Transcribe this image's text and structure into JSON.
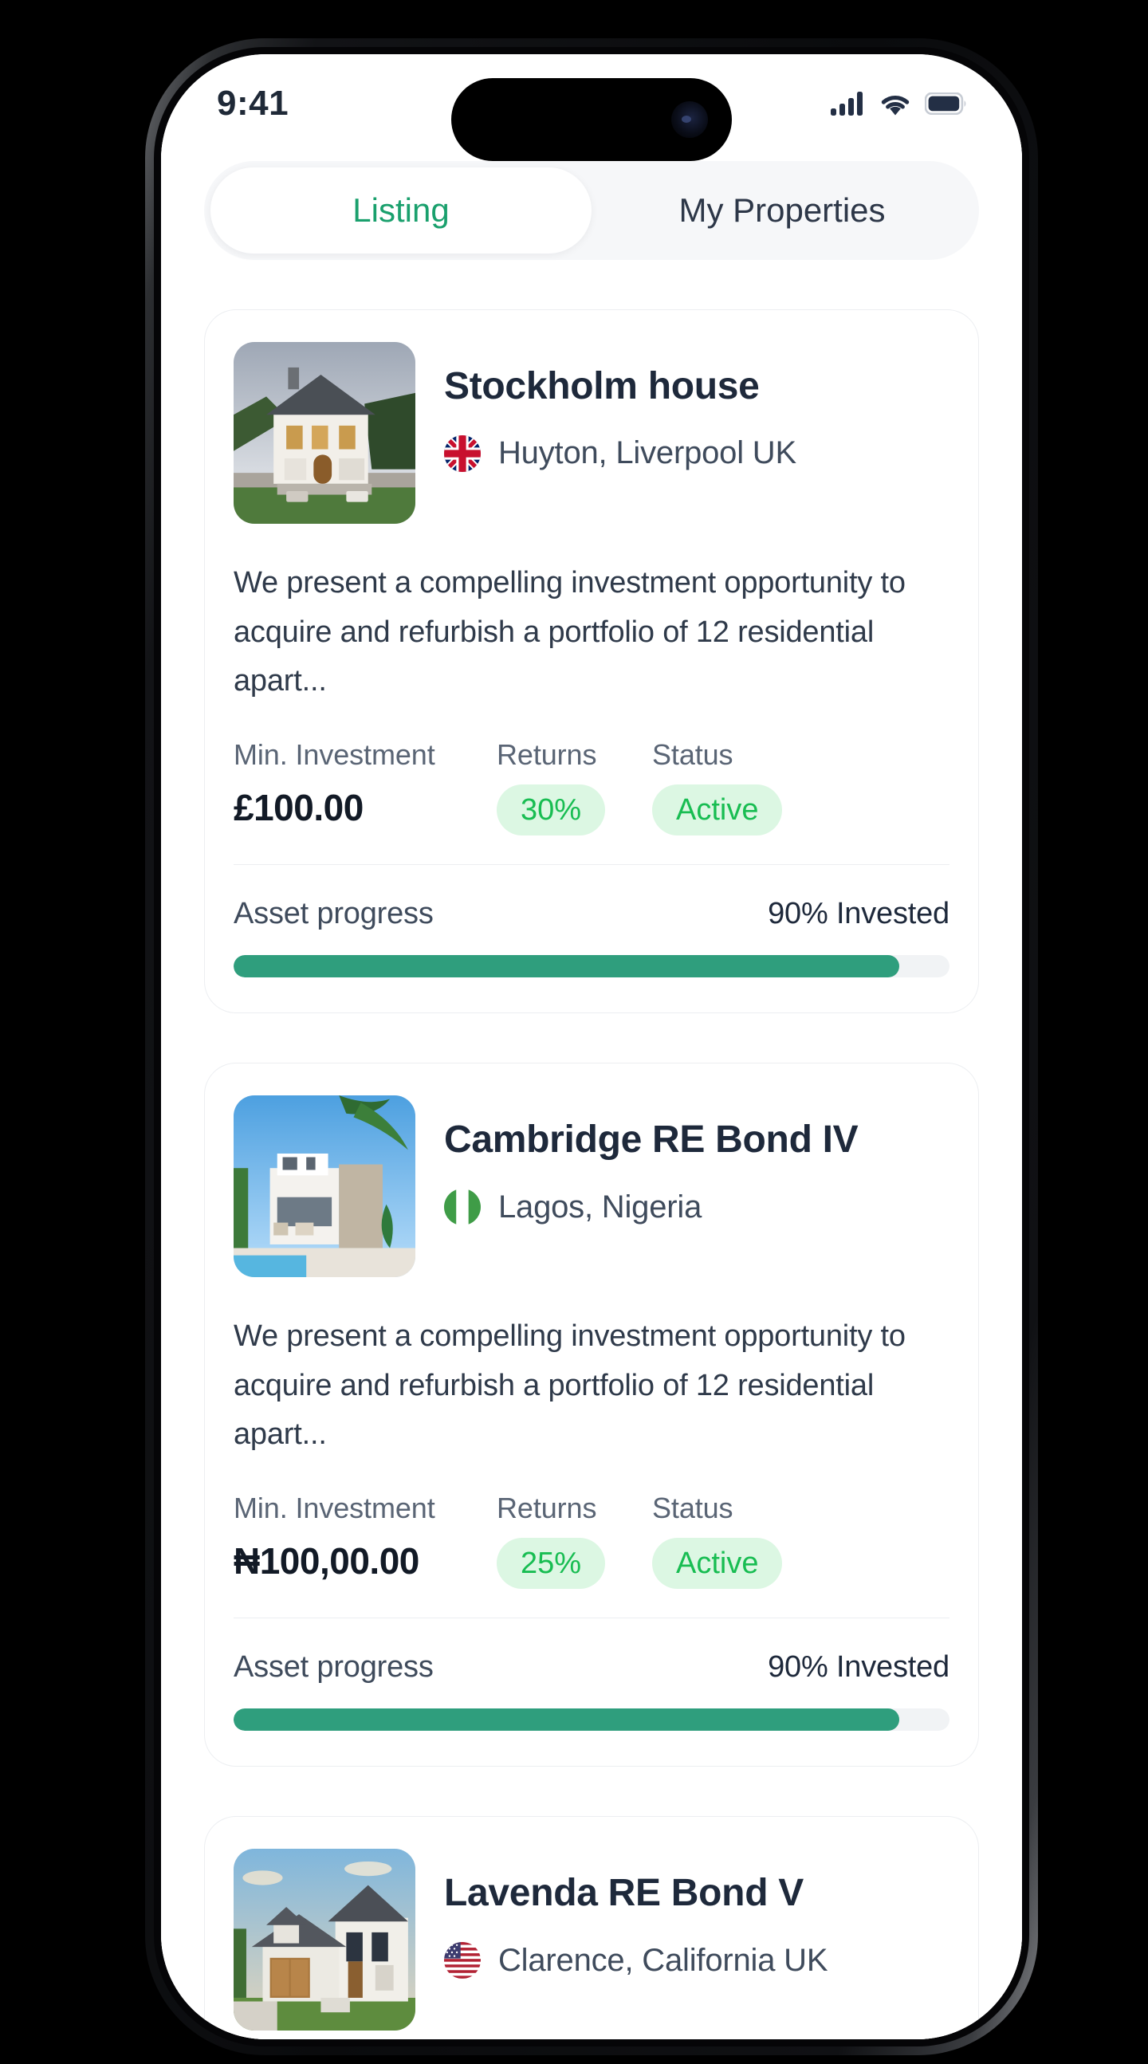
{
  "status_bar": {
    "time": "9:41",
    "icons": [
      "cellular-signal-icon",
      "wifi-icon",
      "battery-icon"
    ],
    "battery_level": 100
  },
  "tabs": {
    "items": [
      {
        "label": "Listing",
        "active": true
      },
      {
        "label": "My Properties",
        "active": false
      }
    ],
    "active_color": "#1aa06d",
    "inactive_color": "#2d3748"
  },
  "labels": {
    "min_investment": "Min. Investment",
    "returns": "Returns",
    "status": "Status",
    "asset_progress": "Asset progress"
  },
  "listings": [
    {
      "title": "Stockholm house",
      "location": "Huyton, Liverpool UK",
      "flag": "uk-flag-icon",
      "thumbnail": "stockholm-house-photo",
      "description": "We present a compelling investment opportunity to acquire and refurbish a portfolio of 12 residential apart...",
      "min_investment": "£100.00",
      "returns": "30%",
      "status": "Active",
      "progress_text": "90% Invested",
      "progress_percent": 93
    },
    {
      "title": "Cambridge RE Bond IV",
      "location": "Lagos, Nigeria",
      "flag": "nigeria-flag-icon",
      "thumbnail": "cambridge-villa-photo",
      "description": "We present a compelling investment opportunity to acquire and refurbish a portfolio of 12 residential apart...",
      "min_investment": "₦100,00.00",
      "returns": "25%",
      "status": "Active",
      "progress_text": "90% Invested",
      "progress_percent": 93
    },
    {
      "title": "Lavenda RE Bond V",
      "location": "Clarence, California UK",
      "flag": "usa-flag-icon",
      "thumbnail": "lavenda-house-photo"
    }
  ],
  "colors": {
    "brand_green": "#1aa06d",
    "pill_bg": "#dcf7e3",
    "pill_text": "#18bd52",
    "progress_fill": "#2f9e7d",
    "progress_track": "#f1f3f5",
    "card_border": "#eceef1",
    "text_dark": "#1e293b",
    "text_muted": "#5a6575",
    "screen_bg": "#ffffff"
  }
}
